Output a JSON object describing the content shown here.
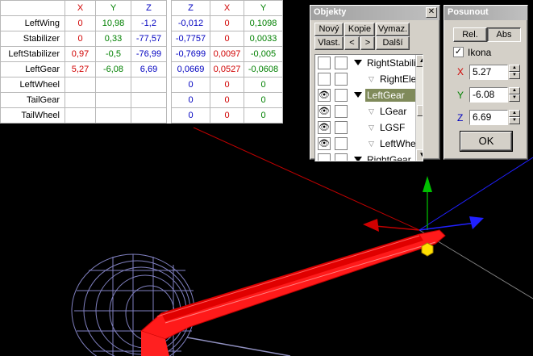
{
  "table": {
    "headers_left": [
      "X",
      "Y",
      "Z"
    ],
    "headers_right": [
      "Z",
      "X",
      "Y"
    ],
    "rows": [
      {
        "name": "LeftWing",
        "x": "0",
        "y": "10,98",
        "z": "-1,2",
        "rz": "-0,012",
        "rx": "0",
        "ry": "0,1098"
      },
      {
        "name": "Stabilizer",
        "x": "0",
        "y": "0,33",
        "z": "-77,57",
        "rz": "-0,7757",
        "rx": "0",
        "ry": "0,0033"
      },
      {
        "name": "LeftStabilizer",
        "x": "0,97",
        "y": "-0,5",
        "z": "-76,99",
        "rz": "-0,7699",
        "rx": "0,0097",
        "ry": "-0,005"
      },
      {
        "name": "LeftGear",
        "x": "5,27",
        "y": "-6,08",
        "z": "6,69",
        "rz": "0,0669",
        "rx": "0,0527",
        "ry": "-0,0608"
      },
      {
        "name": "LeftWheel",
        "x": "",
        "y": "",
        "z": "",
        "rz": "0",
        "rx": "0",
        "ry": "0"
      },
      {
        "name": "TailGear",
        "x": "",
        "y": "",
        "z": "",
        "rz": "0",
        "rx": "0",
        "ry": "0"
      },
      {
        "name": "TailWheel",
        "x": "",
        "y": "",
        "z": "",
        "rz": "0",
        "rx": "0",
        "ry": "0"
      }
    ]
  },
  "objekty": {
    "title": "Objekty",
    "buttons": {
      "novy": "Nový",
      "kopie": "Kopie",
      "vymaz": "Vymaz.",
      "vlast": "Vlast.",
      "prev": "<",
      "next": ">",
      "dalsi": "Další"
    },
    "tree": [
      {
        "label": "RightStabilizer",
        "indent": 1,
        "open": true,
        "eye": false,
        "selected": false
      },
      {
        "label": "RightElevator",
        "indent": 2,
        "open": false,
        "eye": false,
        "selected": false
      },
      {
        "label": "LeftGear",
        "indent": 1,
        "open": true,
        "eye": true,
        "selected": true
      },
      {
        "label": "LGear",
        "indent": 2,
        "open": false,
        "eye": true,
        "selected": false
      },
      {
        "label": "LGSF",
        "indent": 2,
        "open": false,
        "eye": true,
        "selected": false
      },
      {
        "label": "LeftWheel",
        "indent": 2,
        "open": false,
        "eye": true,
        "selected": false
      },
      {
        "label": "RightGear",
        "indent": 1,
        "open": true,
        "eye": false,
        "selected": false
      }
    ]
  },
  "posunout": {
    "title": "Posunout",
    "rel_label": "Rel.",
    "abs_label": "Abs",
    "ikona_label": "Ikona",
    "ikona_checked": "✓",
    "x_label": "X",
    "y_label": "Y",
    "z_label": "Z",
    "x_value": "5.27",
    "y_value": "-6.08",
    "z_value": "6.69",
    "ok_label": "OK"
  },
  "colors": {
    "x_axis": "#d00000",
    "y_axis": "#00a000",
    "z_axis": "#0000ff",
    "mesh": "#ff2020",
    "wire": "#8080c0"
  }
}
